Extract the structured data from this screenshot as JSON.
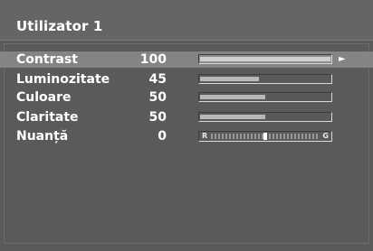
{
  "menu": {
    "title": "Utilizator 1",
    "items": [
      {
        "label": "Contrast",
        "value": "100",
        "level": 100,
        "selected": true
      },
      {
        "label": "Luminozitate",
        "value": "45",
        "level": 45,
        "selected": false
      },
      {
        "label": "Culoare",
        "value": "50",
        "level": 50,
        "selected": false
      },
      {
        "label": "Claritate",
        "value": "50",
        "level": 50,
        "selected": false
      },
      {
        "label": "Nuanță",
        "value": "0",
        "selected": false,
        "tint": {
          "left_label": "R",
          "right_label": "G",
          "position": 0
        }
      }
    ],
    "selected_arrow": "►"
  },
  "colors": {
    "background": "#5a5a5a",
    "header": "#656565",
    "selected_row": "#848484",
    "text": "#ffffff"
  }
}
